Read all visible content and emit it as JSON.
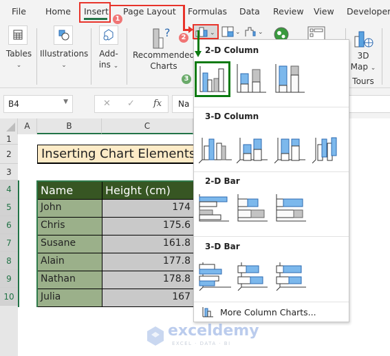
{
  "menu_tabs": [
    "File",
    "Home",
    "Insert",
    "Page Layout",
    "Formulas",
    "Data",
    "Review",
    "View",
    "Developer"
  ],
  "active_tab": "Insert",
  "ribbon": {
    "tables_label": "Tables",
    "illustrations_label": "Illustrations",
    "addins_label_1": "Add-",
    "addins_label_2": "ins",
    "recommended_1": "Recommended",
    "recommended_2": "Charts",
    "map3d_1": "3D",
    "map3d_2": "Map",
    "tours_label": "Tours",
    "chevron": "⌄"
  },
  "formula_bar": {
    "name_box": "B4",
    "fx": "fx",
    "cancel": "✕",
    "enter": "✓",
    "formula": "Na"
  },
  "columns": [
    "A",
    "B",
    "C"
  ],
  "rows": [
    "1",
    "2",
    "3",
    "4",
    "5",
    "6",
    "7",
    "8",
    "9",
    "10"
  ],
  "sheet": {
    "title": "Inserting Chart Elements",
    "headers": [
      "Name",
      "Height (cm)"
    ],
    "data": [
      {
        "name": "John",
        "height": "174"
      },
      {
        "name": "Chris",
        "height": "175.6"
      },
      {
        "name": "Susane",
        "height": "161.8"
      },
      {
        "name": "Alain",
        "height": "177.8"
      },
      {
        "name": "Nathan",
        "height": "178.8"
      },
      {
        "name": "Julia",
        "height": "167"
      }
    ]
  },
  "dropdown": {
    "section_2d_column": "2-D Column",
    "section_3d_column": "3-D Column",
    "section_2d_bar": "2-D Bar",
    "section_3d_bar": "3-D Bar",
    "more_charts": "More Column Charts..."
  },
  "steps": [
    "1",
    "2",
    "3"
  ],
  "colors": {
    "accent_red": "#e8332a",
    "accent_green": "#0a7a10",
    "blue_bar": "#7cb8ec",
    "header_bg": "#375623",
    "name_bg": "#9bb08a",
    "value_bg": "#c9c9c9"
  },
  "watermark": {
    "brand": "exceldemy",
    "tagline": "EXCEL · DATA · BI"
  }
}
